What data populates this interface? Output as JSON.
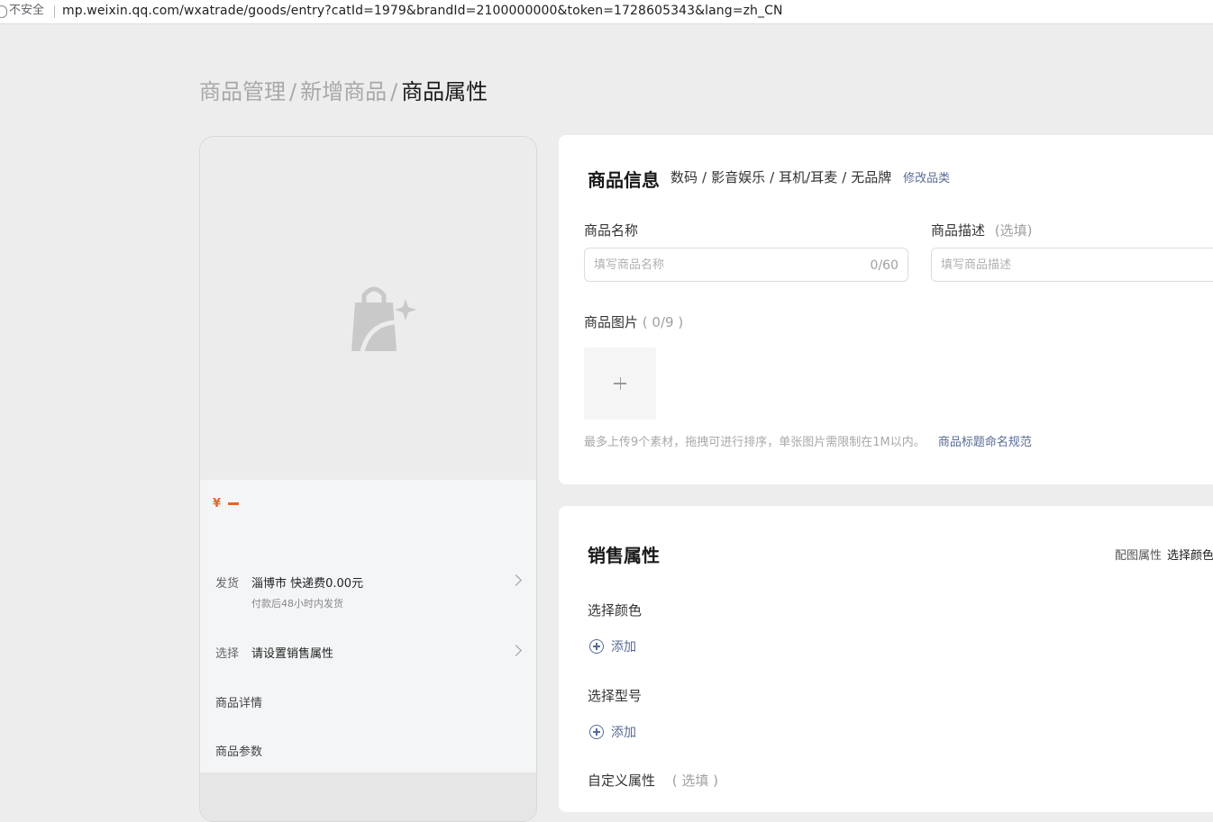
{
  "browser": {
    "security_label": "不安全",
    "url": "mp.weixin.qq.com/wxatrade/goods/entry?catId=1979&brandId=2100000000&token=1728605343&lang=zh_CN"
  },
  "breadcrumb": {
    "items": [
      "商品管理",
      "新增商品",
      "商品属性"
    ],
    "separator": "/"
  },
  "preview": {
    "price_symbol": "¥",
    "shipping": {
      "key": "发货",
      "value": "淄博市 快递费0.00元",
      "sub": "付款后48小时内发货"
    },
    "select": {
      "key": "选择",
      "value": "请设置销售属性"
    },
    "details_label": "商品详情",
    "params_label": "商品参数"
  },
  "product_info": {
    "title": "商品信息",
    "category": [
      "数码",
      "影音娱乐",
      "耳机/耳麦",
      "无品牌"
    ],
    "modify_category": "修改品类",
    "name_label": "商品名称",
    "name_placeholder": "填写商品名称",
    "name_count": "0/60",
    "desc_label": "商品描述",
    "desc_optional": "(选填)",
    "desc_placeholder": "填写商品描述",
    "images_label": "商品图片",
    "images_count": "( 0/9 )",
    "upload_hint": "最多上传9个素材，拖拽可进行排序，单张图片需限制在1M以内。",
    "naming_rules_link": "商品标题命名规范"
  },
  "sales_attributes": {
    "title": "销售属性",
    "config_label": "配图属性",
    "config_value": "选择颜色",
    "color_label": "选择颜色",
    "model_label": "选择型号",
    "add_label": "添加",
    "custom_label": "自定义属性",
    "custom_optional": "( 选填 )"
  },
  "colors": {
    "accent": "#576b95",
    "price": "#e5652b"
  }
}
